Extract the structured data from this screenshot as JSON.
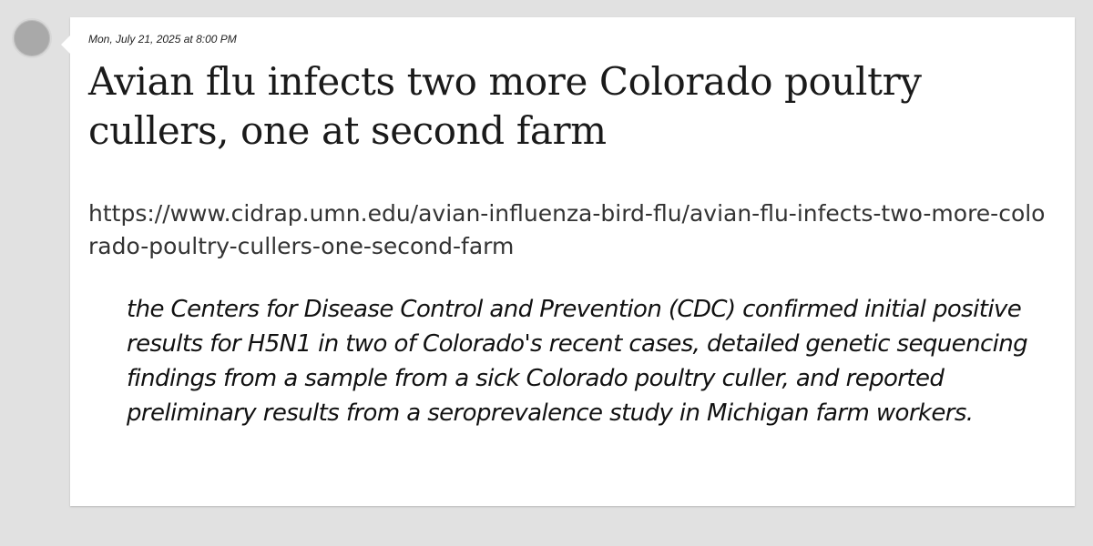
{
  "post": {
    "timestamp": "Mon, July 21, 2025 at 8:00 PM",
    "headline": "Avian flu infects two more Colorado poultry cullers, one at second farm",
    "url": "https://www.cidrap.umn.edu/avian-influenza-bird-flu/avian-flu-infects-two-more-colorado-poultry-cullers-one-second-farm",
    "quote": "the Centers for Disease Control and Prevention (CDC) confirmed initial positive results for H5N1 in two of Colorado's recent cases, detailed genetic sequencing findings from a sample from a sick Colorado poultry culler, and reported preliminary results from a seroprevalence study in Michigan farm workers."
  },
  "colors": {
    "background": "#e1e1e1",
    "card": "#ffffff",
    "avatar": "#a9a9a9"
  }
}
